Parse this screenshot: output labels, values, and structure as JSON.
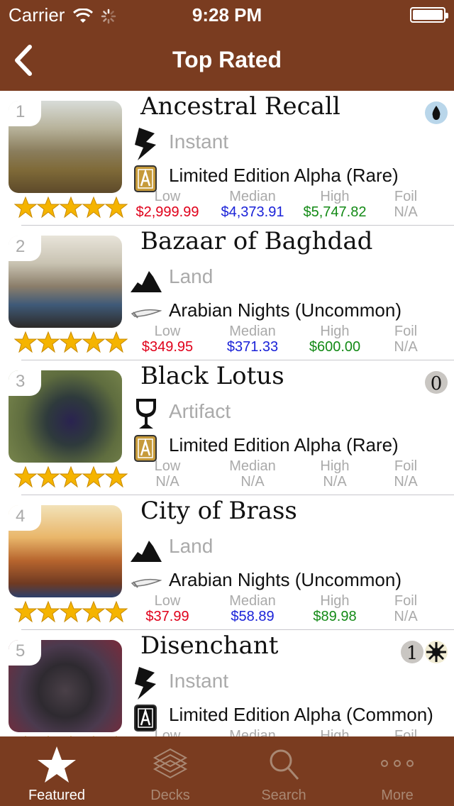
{
  "status": {
    "carrier": "Carrier",
    "time": "9:28 PM"
  },
  "nav": {
    "title": "Top Rated",
    "back_icon": "chevron-left-icon"
  },
  "price_labels": {
    "low": "Low",
    "median": "Median",
    "high": "High",
    "foil": "Foil"
  },
  "cards": [
    {
      "rank": "1",
      "name": "Ancestral Recall",
      "type": "Instant",
      "set": "Limited Edition Alpha (Rare)",
      "type_icon": "lightning-icon",
      "set_icon": "alpha-set-icon",
      "mana": "blue-mana-icon",
      "low": "$2,999.99",
      "median": "$4,373.91",
      "high": "$5,747.82",
      "foil": "N/A",
      "rating": 5
    },
    {
      "rank": "2",
      "name": "Bazaar of Baghdad",
      "type": "Land",
      "set": "Arabian Nights (Uncommon)",
      "type_icon": "mountain-icon",
      "set_icon": "scimitar-icon",
      "mana": "",
      "low": "$349.95",
      "median": "$371.33",
      "high": "$600.00",
      "foil": "N/A",
      "rating": 5
    },
    {
      "rank": "3",
      "name": "Black Lotus",
      "type": "Artifact",
      "set": "Limited Edition Alpha (Rare)",
      "type_icon": "chalice-icon",
      "set_icon": "alpha-set-icon",
      "mana": "0",
      "low": "N/A",
      "median": "N/A",
      "high": "N/A",
      "foil": "N/A",
      "rating": 5
    },
    {
      "rank": "4",
      "name": "City of Brass",
      "type": "Land",
      "set": "Arabian Nights (Uncommon)",
      "type_icon": "mountain-icon",
      "set_icon": "scimitar-icon",
      "mana": "",
      "low": "$37.99",
      "median": "$58.89",
      "high": "$89.98",
      "foil": "N/A",
      "rating": 5
    },
    {
      "rank": "5",
      "name": "Disenchant",
      "type": "Instant",
      "set": "Limited Edition Alpha (Common)",
      "type_icon": "lightning-icon",
      "set_icon": "alpha-set-icon",
      "mana": "1",
      "low": "",
      "median": "",
      "high": "",
      "foil": "",
      "rating": 5
    }
  ],
  "tabs": [
    {
      "label": "Featured",
      "icon": "star-icon",
      "selected": true
    },
    {
      "label": "Decks",
      "icon": "cards-icon",
      "selected": false
    },
    {
      "label": "Search",
      "icon": "search-icon",
      "selected": false
    },
    {
      "label": "More",
      "icon": "more-icon",
      "selected": false
    }
  ]
}
